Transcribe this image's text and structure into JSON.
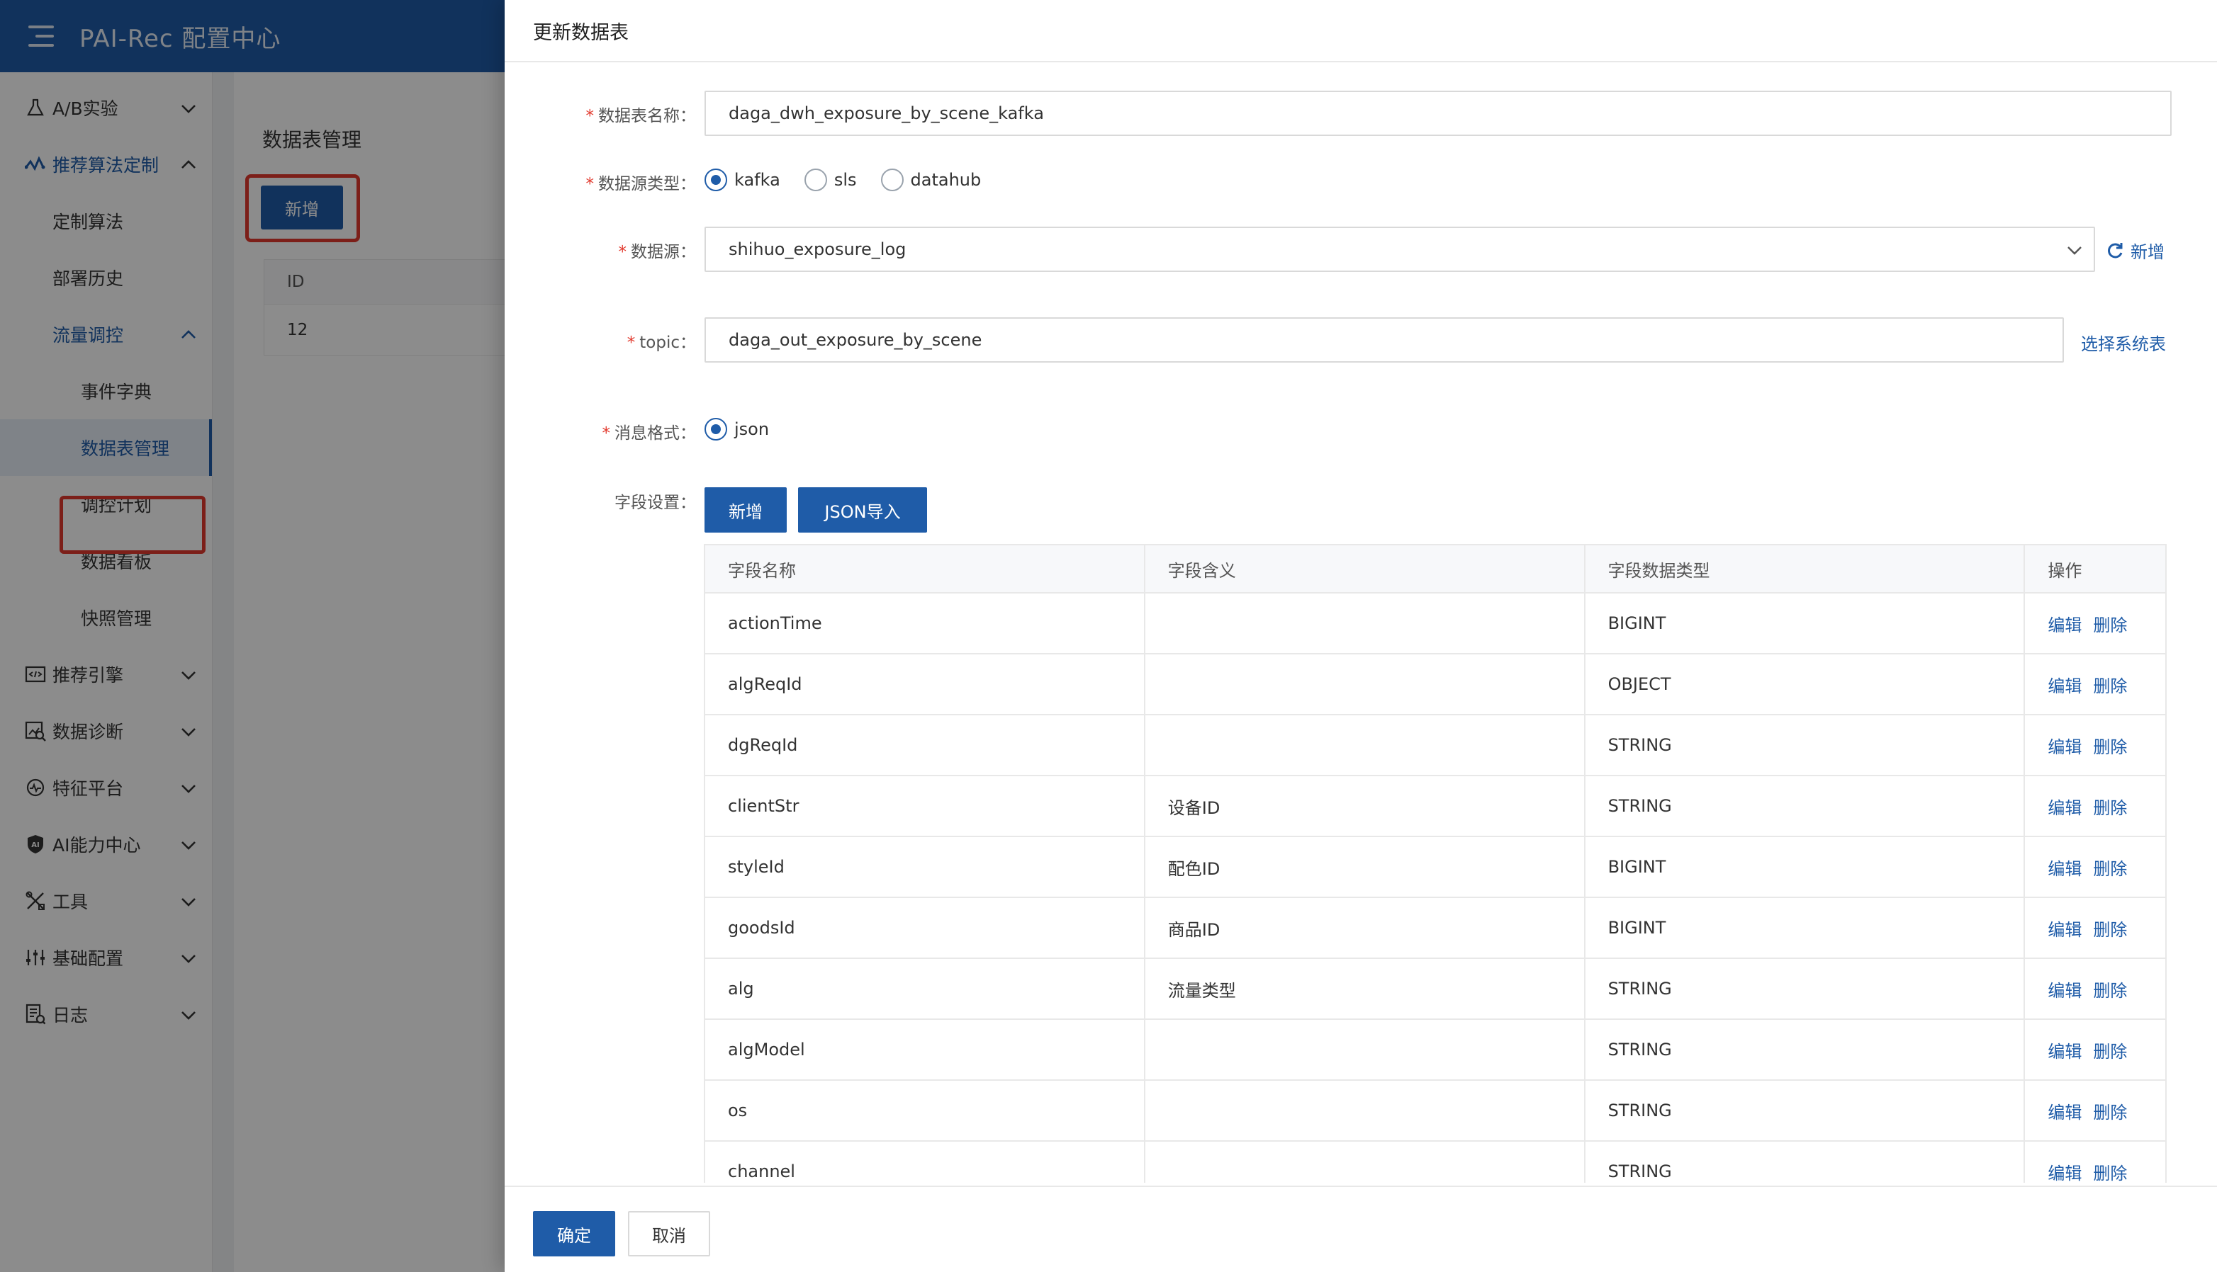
{
  "app": {
    "title": "PAI-Rec 配置中心"
  },
  "sidebar": {
    "items": [
      {
        "label": "A/B实验",
        "icon": "flask-icon",
        "level": 0,
        "expandable": true,
        "expanded": false
      },
      {
        "label": "推荐算法定制",
        "icon": "waveform-icon",
        "level": 0,
        "expandable": true,
        "expanded": true
      },
      {
        "label": "定制算法",
        "level": 1
      },
      {
        "label": "部署历史",
        "level": 1
      },
      {
        "label": "流量调控",
        "level": 1,
        "expandable": true,
        "expanded": true
      },
      {
        "label": "事件字典",
        "level": 2
      },
      {
        "label": "数据表管理",
        "level": 2,
        "selected": true
      },
      {
        "label": "调控计划",
        "level": 2
      },
      {
        "label": "数据看板",
        "level": 2
      },
      {
        "label": "快照管理",
        "level": 2
      },
      {
        "label": "推荐引擎",
        "icon": "code-window-icon",
        "level": 0,
        "expandable": true,
        "expanded": false
      },
      {
        "label": "数据诊断",
        "icon": "chart-search-icon",
        "level": 0,
        "expandable": true,
        "expanded": false
      },
      {
        "label": "特征平台",
        "icon": "pulse-circle-icon",
        "level": 0,
        "expandable": true,
        "expanded": false
      },
      {
        "label": "AI能力中心",
        "icon": "ai-shield-icon",
        "level": 0,
        "expandable": true,
        "expanded": false
      },
      {
        "label": "工具",
        "icon": "tools-icon",
        "level": 0,
        "expandable": true,
        "expanded": false
      },
      {
        "label": "基础配置",
        "icon": "sliders-icon",
        "level": 0,
        "expandable": true,
        "expanded": false
      },
      {
        "label": "日志",
        "icon": "log-icon",
        "level": 0,
        "expandable": true,
        "expanded": false
      }
    ]
  },
  "background_page": {
    "title": "数据表管理",
    "add_button": "新增",
    "table": {
      "header": "ID",
      "rows": [
        "12"
      ]
    }
  },
  "drawer": {
    "title": "更新数据表",
    "table_name": {
      "label": "数据表名称：",
      "value": "daga_dwh_exposure_by_scene_kafka"
    },
    "source_type": {
      "label": "数据源类型：",
      "options": [
        "kafka",
        "sls",
        "datahub"
      ],
      "selected": "kafka"
    },
    "source": {
      "label": "数据源：",
      "value": "shihuo_exposure_log",
      "add_link": "新增"
    },
    "topic": {
      "label": "topic：",
      "value": "daga_out_exposure_by_scene",
      "select_link": "选择系统表"
    },
    "message_format": {
      "label": "消息格式：",
      "options": [
        "json"
      ],
      "selected": "json"
    },
    "fields": {
      "label": "字段设置：",
      "add_button": "新增",
      "json_import_button": "JSON导入",
      "columns": [
        "字段名称",
        "字段含义",
        "字段数据类型",
        "操作"
      ],
      "rows": [
        {
          "name": "actionTime",
          "meaning": "",
          "type": "BIGINT"
        },
        {
          "name": "algReqId",
          "meaning": "",
          "type": "OBJECT"
        },
        {
          "name": "dgReqId",
          "meaning": "",
          "type": "STRING"
        },
        {
          "name": "clientStr",
          "meaning": "设备ID",
          "type": "STRING"
        },
        {
          "name": "styleId",
          "meaning": "配色ID",
          "type": "BIGINT"
        },
        {
          "name": "goodsId",
          "meaning": "商品ID",
          "type": "BIGINT"
        },
        {
          "name": "alg",
          "meaning": "流量类型",
          "type": "STRING"
        },
        {
          "name": "algModel",
          "meaning": "",
          "type": "STRING"
        },
        {
          "name": "os",
          "meaning": "",
          "type": "STRING"
        },
        {
          "name": "channel",
          "meaning": "",
          "type": "STRING"
        }
      ],
      "edit_label": "编辑",
      "delete_label": "删除"
    },
    "confirm_button": "确定",
    "cancel_button": "取消"
  },
  "colors": {
    "brand": "#1f5ca8",
    "highlight_box": "#e23a2e",
    "required": "#e23a2e"
  }
}
